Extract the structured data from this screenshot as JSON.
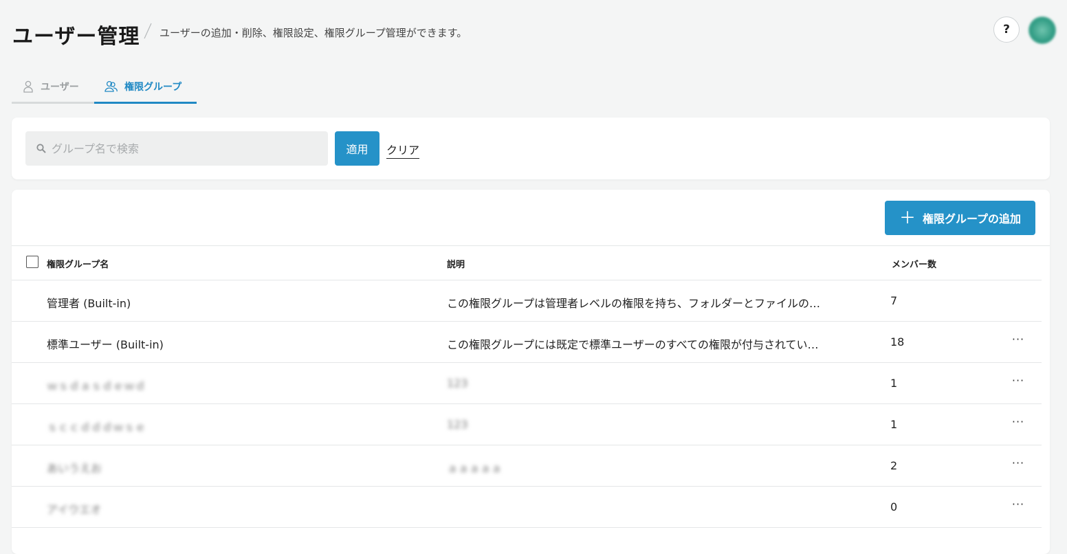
{
  "header": {
    "title": "ユーザー管理",
    "description": "ユーザーの追加・削除、権限設定、権限グループ管理ができます。",
    "help_label": "?"
  },
  "tabs": [
    {
      "label": "ユーザー",
      "active": false,
      "icon": "user-icon"
    },
    {
      "label": "権限グループ",
      "active": true,
      "icon": "users-icon"
    }
  ],
  "search": {
    "placeholder": "グループ名で検索",
    "value": "",
    "apply_label": "適用",
    "clear_label": "クリア"
  },
  "table": {
    "add_button_label": "権限グループの追加",
    "columns": [
      "権限グループ名",
      "説明",
      "メンバー数"
    ],
    "rows": [
      {
        "name": "管理者 (Built-in)",
        "description": "この権限グループは管理者レベルの権限を持ち、フォルダーとファイルの…",
        "members": "7",
        "has_menu": false,
        "blurred": false
      },
      {
        "name": "標準ユーザー (Built-in)",
        "description": "この権限グループには既定で標準ユーザーのすべての権限が付与されてい…",
        "members": "18",
        "has_menu": true,
        "blurred": false
      },
      {
        "name": "ｗｓｄａｓｄｅｗｄ",
        "description": "123",
        "members": "1",
        "has_menu": true,
        "blurred": true
      },
      {
        "name": "ｓｃｃｄｄｄｗｓｅ",
        "description": "123",
        "members": "1",
        "has_menu": true,
        "blurred": true
      },
      {
        "name": "あいうえお",
        "description": "ａａａａａ",
        "members": "2",
        "has_menu": true,
        "blurred": true
      },
      {
        "name": "アイウエオ",
        "description": "",
        "members": "0",
        "has_menu": true,
        "blurred": true
      }
    ],
    "row_menu_label": "···"
  },
  "colors": {
    "accent": "#2592c8",
    "tab_active": "#2089c4",
    "background": "#f4f5f5"
  }
}
